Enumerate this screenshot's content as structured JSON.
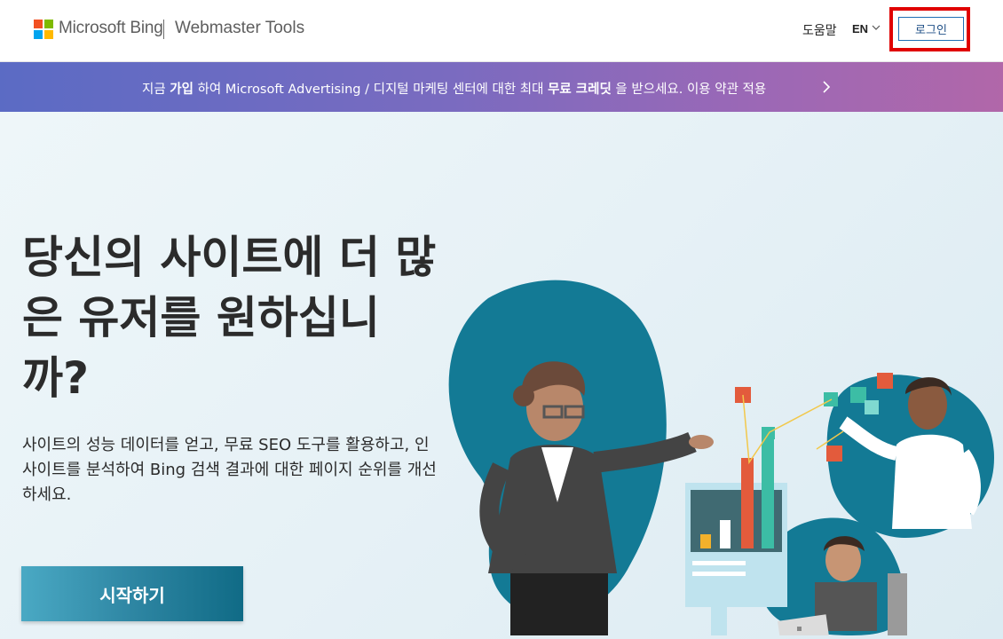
{
  "header": {
    "brand": "Microsoft Bing",
    "product": "Webmaster Tools",
    "help_label": "도움말",
    "lang_label": "EN",
    "login_label": "로그인"
  },
  "banner": {
    "part1": "지금 ",
    "bold1": "가입",
    "part2": " 하여 Microsoft Advertising / 디지털 마케팅 센터에 대한 최대 ",
    "bold2": "무료 크레딧",
    "part3": " 을 받으세요. 이용 약관 적용"
  },
  "hero": {
    "title": "당신의 사이트에 더 많은 유저를 원하십니까?",
    "subtitle": "사이트의 성능 데이터를 얻고, 무료 SEO 도구를 활용하고, 인사이트를 분석하여 Bing 검색 결과에 대한 페이지 순위를 개선하세요.",
    "cta_label": "시작하기"
  },
  "colors": {
    "logo_red": "#f25022",
    "logo_green": "#7fba00",
    "logo_blue": "#00a4ef",
    "logo_yellow": "#ffb900",
    "accent_teal": "#1a7a95",
    "highlight_red": "#e00000"
  },
  "icons": {
    "logo": "microsoft-logo-icon",
    "lang": "chevron-down-icon",
    "banner": "chevron-right-icon"
  }
}
